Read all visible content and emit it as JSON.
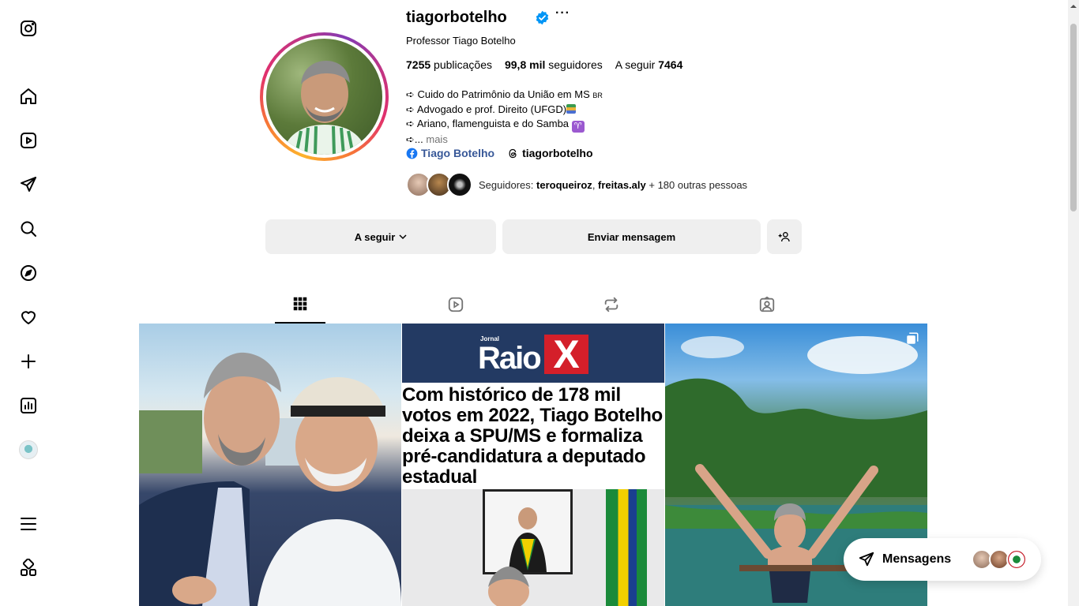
{
  "sidebar": {
    "items": [
      {
        "name": "instagram-logo-icon"
      },
      {
        "name": "home-icon"
      },
      {
        "name": "reels-icon"
      },
      {
        "name": "direct-icon"
      },
      {
        "name": "search-icon"
      },
      {
        "name": "explore-icon"
      },
      {
        "name": "notifications-icon"
      },
      {
        "name": "create-icon"
      },
      {
        "name": "dashboard-icon"
      },
      {
        "name": "profile-icon"
      },
      {
        "name": "menu-icon"
      },
      {
        "name": "also-from-meta-icon"
      }
    ]
  },
  "profile": {
    "username": "tiagorbotelho",
    "more": "···",
    "full_name": "Professor Tiago Botelho",
    "posts_count": "7255",
    "posts_label": "publicações",
    "followers_count": "99,8 mil",
    "followers_label": "seguidores",
    "following_label": "A seguir",
    "following_count": "7464",
    "bio": [
      {
        "prefix": "➪",
        "text": "Cuido do Patrimônio da União em MS",
        "suffix": "BR"
      },
      {
        "prefix": "➪",
        "text": "Advogado e prof. Direito (UFGD)"
      },
      {
        "prefix": "➪",
        "text": "Ariano, flamenguista e do Samba",
        "suffix": "♈"
      },
      {
        "prefix": "➪",
        "text": "...",
        "more": "mais"
      }
    ],
    "links": {
      "facebook": "Tiago Botelho",
      "threads": "tiagorbotelho"
    },
    "followed_by": {
      "label": "Seguidores:",
      "user1": "teroqueiroz",
      "user2": "freitas.aly",
      "rest": "+ 180 outras pessoas"
    }
  },
  "buttons": {
    "following": "A seguir",
    "message": "Enviar mensagem"
  },
  "tabs": [
    {
      "name": "posts-tab",
      "active": true
    },
    {
      "name": "reels-tab",
      "active": false
    },
    {
      "name": "reposts-tab",
      "active": false
    },
    {
      "name": "tagged-tab",
      "active": false
    }
  ],
  "posts": {
    "post2": {
      "jornal": "Jornal",
      "raio": "Raio",
      "x": "X",
      "headline": "Com histórico de 178 mil votos em 2022, Tiago Botelho deixa a SPU/MS e formaliza pré-candidatura a deputado estadual"
    }
  },
  "messages": {
    "label": "Mensagens"
  },
  "colors": {
    "link_blue": "#385898",
    "verified_blue": "#0095f6",
    "button_bg": "#efefef",
    "raio_navy": "#233a63",
    "raio_red": "#d41f2a"
  }
}
